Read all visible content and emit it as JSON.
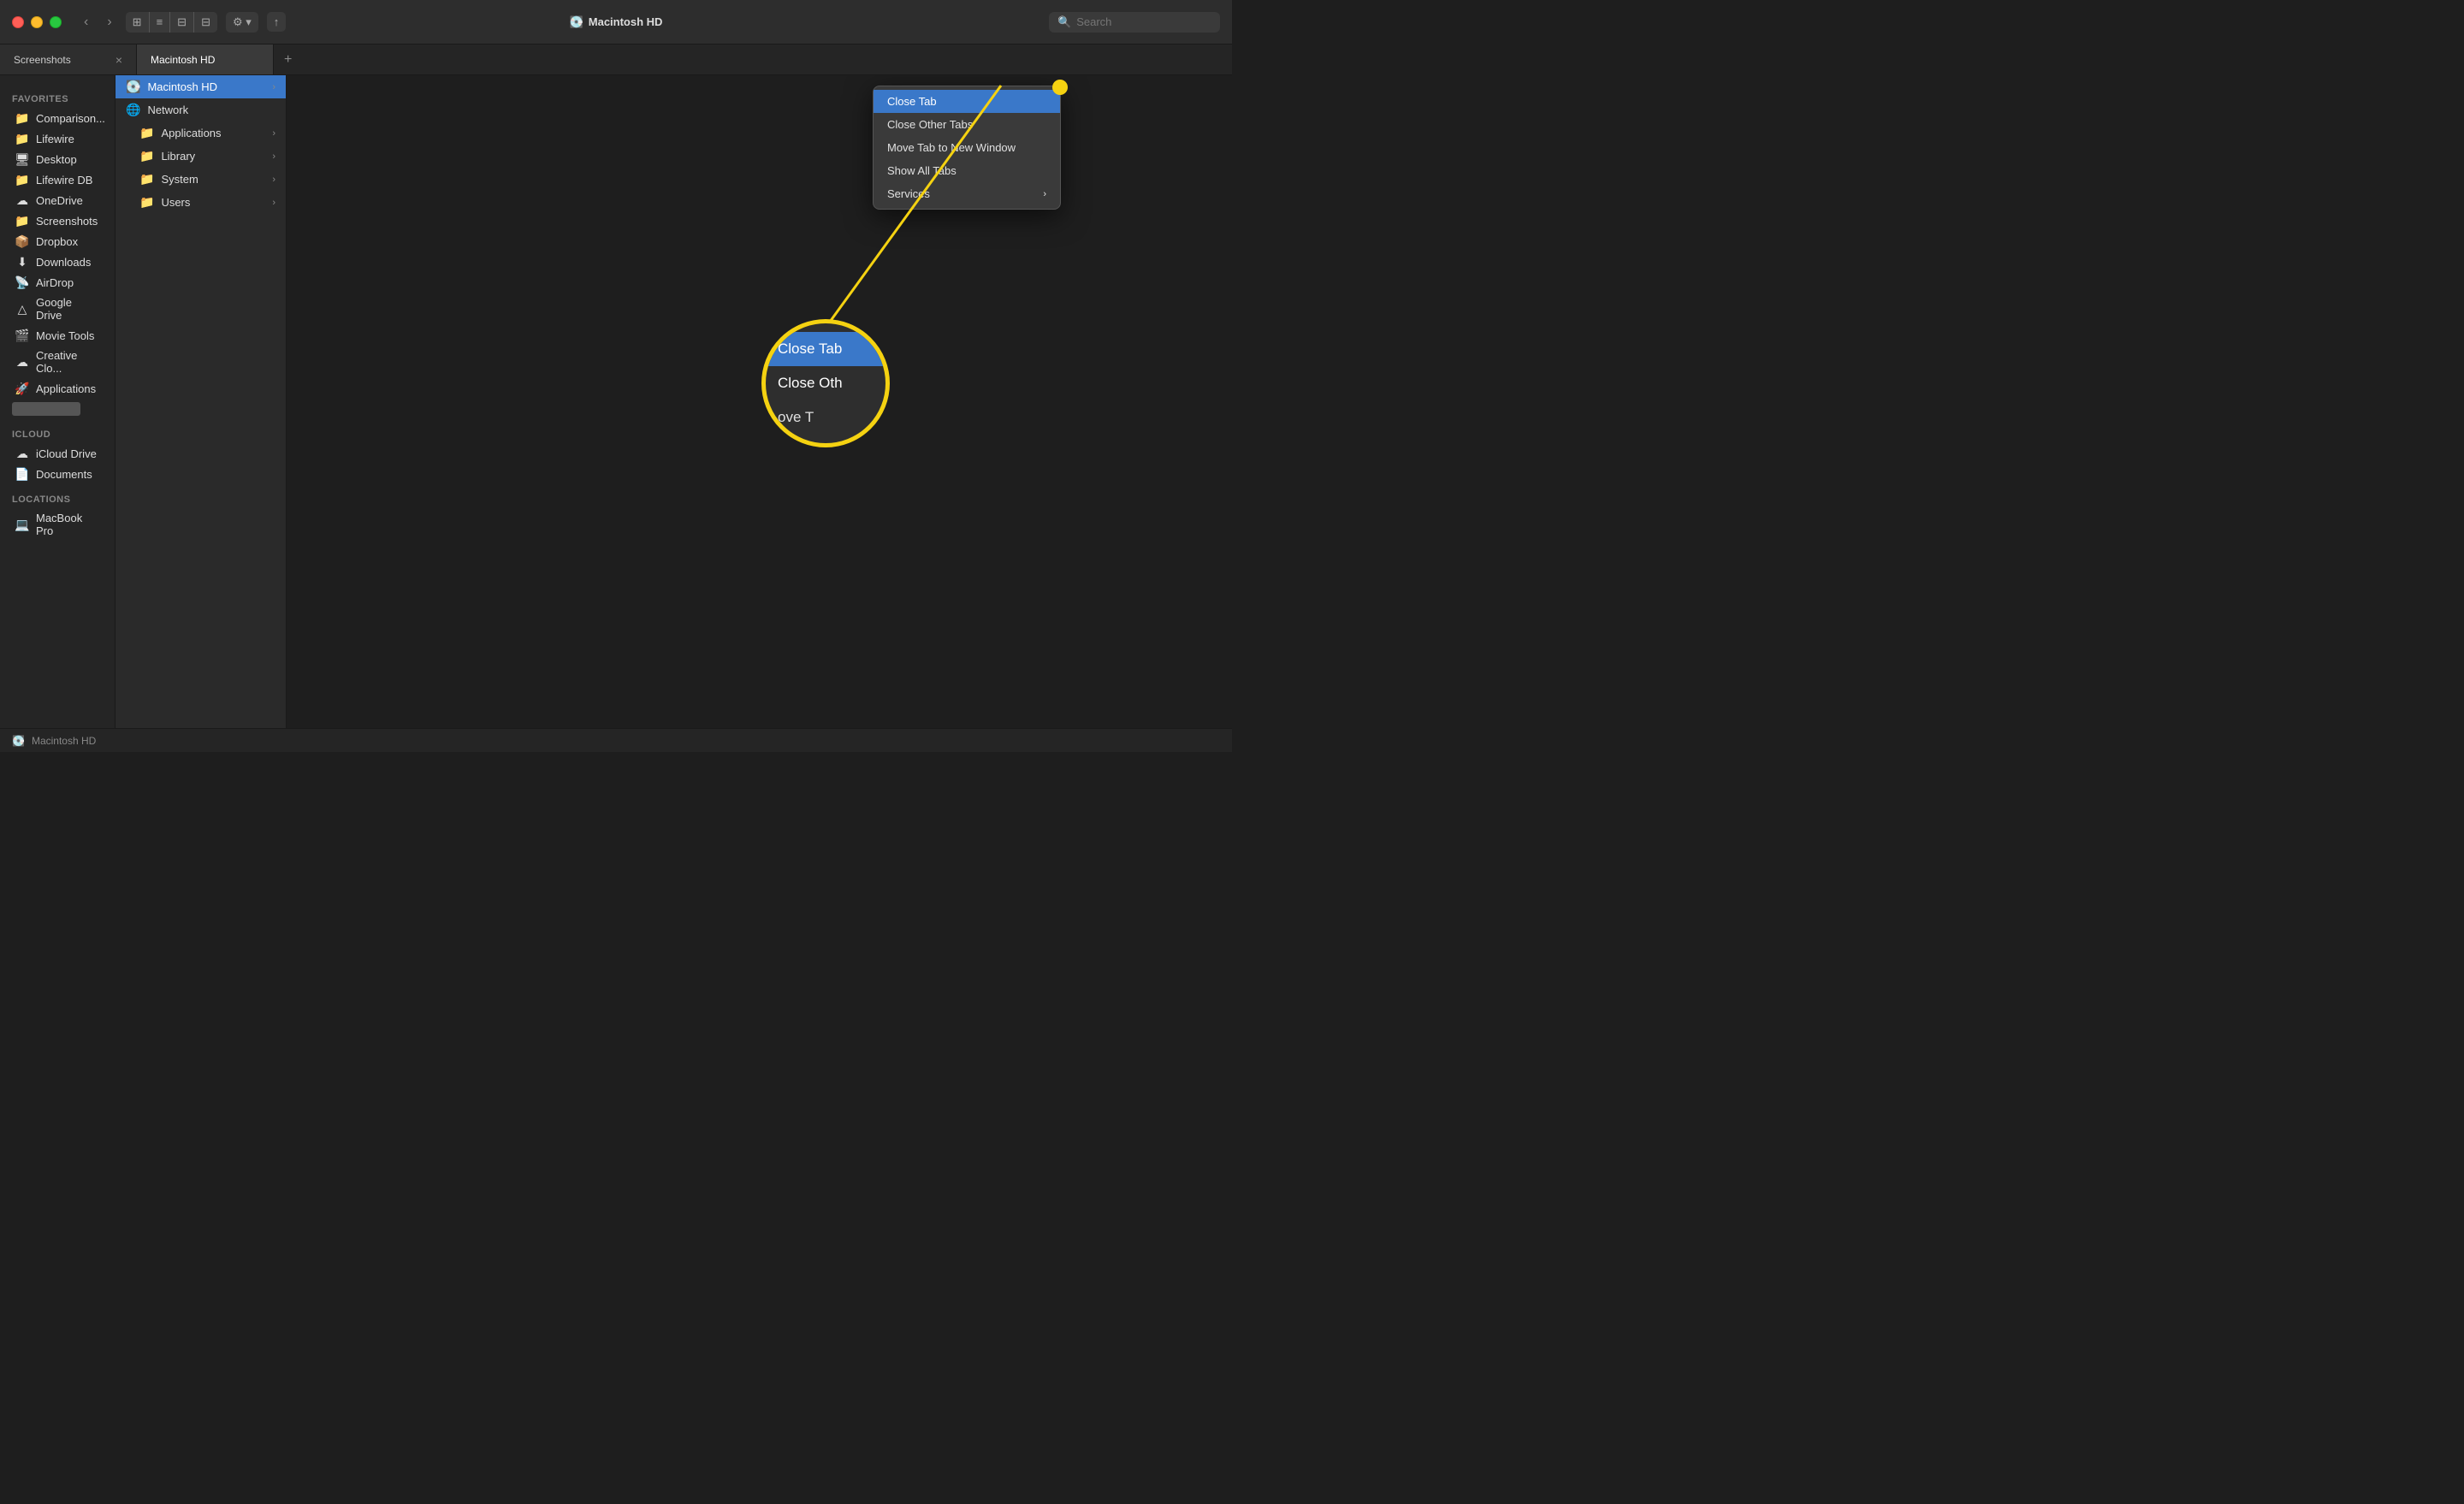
{
  "window": {
    "title": "Macintosh HD",
    "screenshot_tab": "Screenshots",
    "macintosh_tab": "Macintosh HD"
  },
  "toolbar": {
    "back_label": "‹",
    "forward_label": "›",
    "view1_label": "⊞",
    "view2_label": "≡",
    "view3_label": "⊟",
    "view4_label": "⊟",
    "action_label": "⚙",
    "share_label": "↑",
    "search_placeholder": "Search"
  },
  "tabs": [
    {
      "label": "Screenshots",
      "active": false
    },
    {
      "label": "Macintosh HD",
      "active": true
    }
  ],
  "sidebar": {
    "sections": [
      {
        "label": "Favorites",
        "items": [
          {
            "name": "Comparison...",
            "icon": "📁"
          },
          {
            "name": "Lifewire",
            "icon": "📁"
          },
          {
            "name": "Desktop",
            "icon": "🖥"
          },
          {
            "name": "Lifewire DB",
            "icon": "📁"
          },
          {
            "name": "OneDrive",
            "icon": "☁"
          },
          {
            "name": "Screenshots",
            "icon": "📁"
          },
          {
            "name": "Dropbox",
            "icon": "📦"
          },
          {
            "name": "Downloads",
            "icon": "⬇"
          },
          {
            "name": "AirDrop",
            "icon": "📡"
          },
          {
            "name": "Google Drive",
            "icon": "△"
          },
          {
            "name": "Movie Tools",
            "icon": "🎬"
          },
          {
            "name": "Creative Clo...",
            "icon": "☁"
          },
          {
            "name": "Applications",
            "icon": "🚀"
          }
        ]
      },
      {
        "label": "iCloud",
        "items": [
          {
            "name": "iCloud Drive",
            "icon": "☁"
          },
          {
            "name": "Documents",
            "icon": "📄"
          }
        ]
      },
      {
        "label": "Locations",
        "items": [
          {
            "name": "MacBook Pro",
            "icon": "💻"
          }
        ]
      }
    ]
  },
  "file_pane": {
    "header": "Macintosh HD",
    "items": [
      {
        "name": "Applications",
        "has_arrow": true
      },
      {
        "name": "Library",
        "has_arrow": true
      },
      {
        "name": "System",
        "has_arrow": true
      },
      {
        "name": "Users",
        "has_arrow": true
      }
    ],
    "network": "Network"
  },
  "context_menu": {
    "items": [
      {
        "label": "Close Tab",
        "active": true,
        "has_submenu": false
      },
      {
        "label": "Close Other Tabs",
        "active": false,
        "has_submenu": false
      },
      {
        "label": "Move Tab to New Window",
        "active": false,
        "has_submenu": false
      },
      {
        "label": "Show All Tabs",
        "active": false,
        "has_submenu": false
      },
      {
        "label": "Services",
        "active": false,
        "has_submenu": true
      }
    ]
  },
  "zoom": {
    "items": [
      {
        "label": "Close Tab",
        "active": true
      },
      {
        "label": "Close Oth",
        "active": false
      },
      {
        "label": "ove T",
        "active": false,
        "partial": true
      }
    ]
  },
  "status_bar": {
    "location": "Macintosh HD",
    "icon": "💽"
  }
}
